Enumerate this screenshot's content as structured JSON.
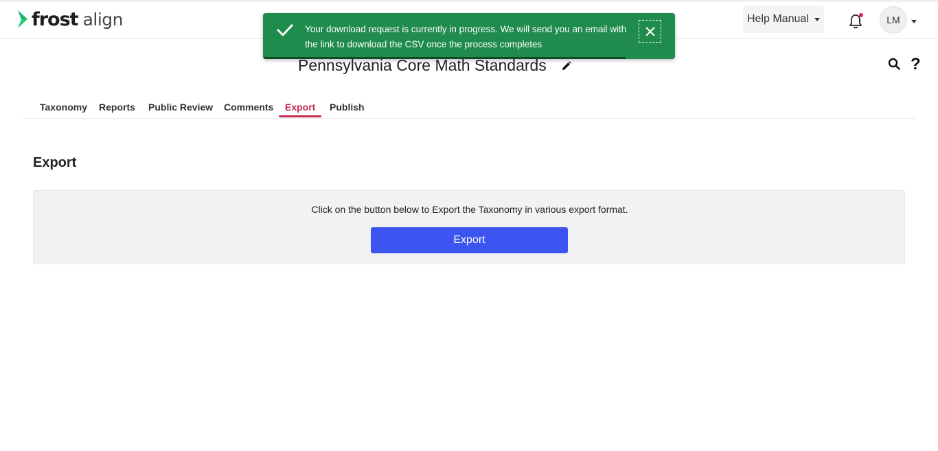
{
  "brand": {
    "name_main": "frost",
    "name_sub": "align",
    "accent_color": "#1fcf7a"
  },
  "header": {
    "help_menu_label": "Help Manual",
    "avatar_initials": "LM",
    "notification_indicator_color": "#d9214f"
  },
  "toast": {
    "message": "Your download request is currently in progress. We will send you an email with the link to download the CSV once the process completes",
    "background_color": "#1f8b4c",
    "progress_fraction": 0.88,
    "icons": [
      "check-icon",
      "close-icon"
    ]
  },
  "document": {
    "title": "Pennsylvania Core Math Standards"
  },
  "tabs": [
    {
      "label": "Taxonomy",
      "active": false
    },
    {
      "label": "Reports",
      "active": false
    },
    {
      "label": "Public Review",
      "active": false
    },
    {
      "label": "Comments",
      "active": false
    },
    {
      "label": "Export",
      "active": true
    },
    {
      "label": "Publish",
      "active": false
    }
  ],
  "export_section": {
    "heading": "Export",
    "description": "Click on the button below to Export the Taxonomy in various export format.",
    "button_label": "Export",
    "button_color": "#3d55f0"
  },
  "active_tab_color": "#c4284f"
}
